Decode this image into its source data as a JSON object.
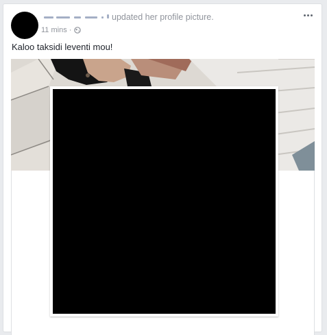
{
  "post": {
    "headline_text": "updated her profile picture.",
    "timestamp": "11 mins",
    "separator": "·",
    "privacy_icon": "globe-icon",
    "more_icon": "ellipsis-icon",
    "caption": "Kaloo taksidi leventi mou!"
  },
  "colors": {
    "muted_text": "#90949c",
    "body_text": "#1d2129",
    "card_border": "#dddfe2",
    "page_bg": "#e9ebee"
  }
}
